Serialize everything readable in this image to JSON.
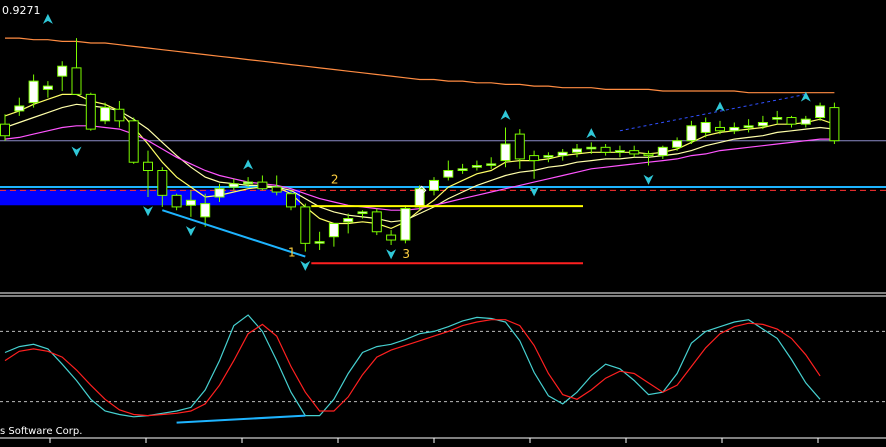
{
  "header": {
    "price_readout": "0.9271",
    "copyright": "s Software Corp."
  },
  "colors": {
    "background": "#000000",
    "bull_candle": "#ffffff",
    "bear_candle": "#000000",
    "candle_outline": "#7CFC00",
    "ma_fast": "#ffff66",
    "ma_mid": "#ffffaa",
    "ma_slow": "#ff55ff",
    "ma_long": "#ff8c42",
    "support_zone": "#0000ff",
    "support_line": "#1eb4ff",
    "fractal_arrow": "#30c8d8",
    "stoch_main": "#46d0d0",
    "stoch_signal": "#ff2020",
    "label_text": "#ffd040",
    "frame": "#ffffff"
  },
  "chart_data": [
    {
      "type": "candlestick",
      "title": "",
      "candles": [
        {
          "o": 0.4,
          "h": 0.46,
          "l": 0.3,
          "c": 0.33
        },
        {
          "o": 0.48,
          "h": 0.56,
          "l": 0.45,
          "c": 0.51
        },
        {
          "o": 0.53,
          "h": 0.7,
          "l": 0.5,
          "c": 0.66
        },
        {
          "o": 0.61,
          "h": 0.66,
          "l": 0.56,
          "c": 0.63
        },
        {
          "o": 0.69,
          "h": 0.78,
          "l": 0.6,
          "c": 0.75
        },
        {
          "o": 0.74,
          "h": 0.92,
          "l": 0.7,
          "c": 0.58
        },
        {
          "o": 0.58,
          "h": 0.59,
          "l": 0.36,
          "c": 0.37
        },
        {
          "o": 0.42,
          "h": 0.53,
          "l": 0.4,
          "c": 0.5
        },
        {
          "o": 0.49,
          "h": 0.54,
          "l": 0.38,
          "c": 0.42
        },
        {
          "o": 0.42,
          "h": 0.44,
          "l": 0.16,
          "c": 0.17
        },
        {
          "o": 0.17,
          "h": 0.24,
          "l": -0.04,
          "c": 0.12
        },
        {
          "o": 0.12,
          "h": 0.14,
          "l": -0.1,
          "c": -0.03
        },
        {
          "o": -0.03,
          "h": -0.02,
          "l": -0.12,
          "c": -0.1
        },
        {
          "o": -0.09,
          "h": 0.0,
          "l": -0.16,
          "c": -0.06
        },
        {
          "o": -0.16,
          "h": -0.02,
          "l": -0.22,
          "c": -0.08
        },
        {
          "o": -0.04,
          "h": 0.04,
          "l": -0.07,
          "c": 0.01
        },
        {
          "o": 0.02,
          "h": 0.07,
          "l": 0.0,
          "c": 0.04
        },
        {
          "o": 0.04,
          "h": 0.08,
          "l": 0.02,
          "c": 0.05
        },
        {
          "o": 0.05,
          "h": 0.09,
          "l": 0.0,
          "c": 0.01
        },
        {
          "o": 0.02,
          "h": 0.09,
          "l": -0.03,
          "c": -0.01
        },
        {
          "o": -0.02,
          "h": 0.0,
          "l": -0.12,
          "c": -0.1
        },
        {
          "o": -0.1,
          "h": -0.08,
          "l": -0.37,
          "c": -0.32
        },
        {
          "o": -0.31,
          "h": -0.25,
          "l": -0.36,
          "c": -0.31
        },
        {
          "o": -0.28,
          "h": -0.2,
          "l": -0.34,
          "c": -0.2
        },
        {
          "o": -0.19,
          "h": -0.14,
          "l": -0.26,
          "c": -0.17
        },
        {
          "o": -0.14,
          "h": -0.12,
          "l": -0.17,
          "c": -0.13
        },
        {
          "o": -0.13,
          "h": -0.11,
          "l": -0.27,
          "c": -0.25
        },
        {
          "o": -0.27,
          "h": -0.24,
          "l": -0.33,
          "c": -0.3
        },
        {
          "o": -0.3,
          "h": -0.09,
          "l": -0.32,
          "c": -0.11
        },
        {
          "o": -0.1,
          "h": 0.03,
          "l": -0.12,
          "c": 0.01
        },
        {
          "o": 0.0,
          "h": 0.08,
          "l": -0.03,
          "c": 0.06
        },
        {
          "o": 0.08,
          "h": 0.18,
          "l": 0.06,
          "c": 0.12
        },
        {
          "o": 0.12,
          "h": 0.16,
          "l": 0.1,
          "c": 0.13
        },
        {
          "o": 0.14,
          "h": 0.18,
          "l": 0.12,
          "c": 0.15
        },
        {
          "o": 0.16,
          "h": 0.2,
          "l": 0.13,
          "c": 0.16
        },
        {
          "o": 0.18,
          "h": 0.38,
          "l": 0.14,
          "c": 0.28
        },
        {
          "o": 0.34,
          "h": 0.37,
          "l": 0.13,
          "c": 0.19
        },
        {
          "o": 0.21,
          "h": 0.24,
          "l": 0.07,
          "c": 0.18
        },
        {
          "o": 0.2,
          "h": 0.23,
          "l": 0.17,
          "c": 0.21
        },
        {
          "o": 0.21,
          "h": 0.25,
          "l": 0.18,
          "c": 0.23
        },
        {
          "o": 0.23,
          "h": 0.28,
          "l": 0.2,
          "c": 0.25
        },
        {
          "o": 0.26,
          "h": 0.29,
          "l": 0.22,
          "c": 0.26
        },
        {
          "o": 0.26,
          "h": 0.28,
          "l": 0.21,
          "c": 0.23
        },
        {
          "o": 0.23,
          "h": 0.27,
          "l": 0.2,
          "c": 0.24
        },
        {
          "o": 0.24,
          "h": 0.27,
          "l": 0.2,
          "c": 0.22
        },
        {
          "o": 0.22,
          "h": 0.24,
          "l": 0.15,
          "c": 0.21
        },
        {
          "o": 0.21,
          "h": 0.27,
          "l": 0.19,
          "c": 0.26
        },
        {
          "o": 0.26,
          "h": 0.32,
          "l": 0.24,
          "c": 0.3
        },
        {
          "o": 0.3,
          "h": 0.42,
          "l": 0.28,
          "c": 0.39
        },
        {
          "o": 0.35,
          "h": 0.44,
          "l": 0.32,
          "c": 0.41
        },
        {
          "o": 0.38,
          "h": 0.42,
          "l": 0.34,
          "c": 0.36
        },
        {
          "o": 0.36,
          "h": 0.41,
          "l": 0.34,
          "c": 0.38
        },
        {
          "o": 0.38,
          "h": 0.43,
          "l": 0.35,
          "c": 0.39
        },
        {
          "o": 0.39,
          "h": 0.45,
          "l": 0.37,
          "c": 0.41
        },
        {
          "o": 0.43,
          "h": 0.48,
          "l": 0.4,
          "c": 0.44
        },
        {
          "o": 0.44,
          "h": 0.45,
          "l": 0.38,
          "c": 0.4
        },
        {
          "o": 0.4,
          "h": 0.45,
          "l": 0.38,
          "c": 0.43
        },
        {
          "o": 0.44,
          "h": 0.53,
          "l": 0.42,
          "c": 0.51
        },
        {
          "o": 0.5,
          "h": 0.53,
          "l": 0.28,
          "c": 0.3
        }
      ],
      "moving_averages": [
        {
          "role": "ma_fast",
          "values": [
            0.45,
            0.48,
            0.52,
            0.55,
            0.58,
            0.58,
            0.54,
            0.52,
            0.48,
            0.38,
            0.28,
            0.17,
            0.08,
            0.02,
            -0.04,
            -0.03,
            -0.01,
            0.01,
            0.02,
            0.02,
            -0.02,
            -0.1,
            -0.17,
            -0.2,
            -0.2,
            -0.19,
            -0.2,
            -0.23,
            -0.19,
            -0.12,
            -0.06,
            0.02,
            0.06,
            0.1,
            0.12,
            0.17,
            0.18,
            0.18,
            0.19,
            0.21,
            0.22,
            0.23,
            0.23,
            0.23,
            0.23,
            0.22,
            0.23,
            0.25,
            0.29,
            0.33,
            0.35,
            0.36,
            0.37,
            0.38,
            0.4,
            0.4,
            0.41,
            0.43,
            0.4
          ]
        },
        {
          "role": "ma_mid",
          "values": [
            0.38,
            0.41,
            0.44,
            0.47,
            0.5,
            0.52,
            0.51,
            0.5,
            0.48,
            0.43,
            0.37,
            0.29,
            0.21,
            0.14,
            0.08,
            0.05,
            0.04,
            0.03,
            0.03,
            0.02,
            0.0,
            -0.05,
            -0.1,
            -0.13,
            -0.15,
            -0.16,
            -0.17,
            -0.19,
            -0.18,
            -0.14,
            -0.1,
            -0.05,
            -0.01,
            0.03,
            0.06,
            0.09,
            0.11,
            0.12,
            0.14,
            0.15,
            0.17,
            0.18,
            0.19,
            0.19,
            0.2,
            0.2,
            0.21,
            0.22,
            0.24,
            0.27,
            0.29,
            0.31,
            0.32,
            0.33,
            0.35,
            0.36,
            0.37,
            0.38,
            0.37
          ]
        },
        {
          "role": "ma_slow",
          "values": [
            0.31,
            0.32,
            0.34,
            0.36,
            0.38,
            0.39,
            0.39,
            0.38,
            0.37,
            0.34,
            0.3,
            0.25,
            0.2,
            0.16,
            0.12,
            0.09,
            0.07,
            0.05,
            0.04,
            0.03,
            0.01,
            -0.02,
            -0.05,
            -0.07,
            -0.09,
            -0.1,
            -0.11,
            -0.12,
            -0.12,
            -0.11,
            -0.09,
            -0.07,
            -0.05,
            -0.03,
            -0.01,
            0.01,
            0.03,
            0.05,
            0.07,
            0.09,
            0.11,
            0.13,
            0.14,
            0.15,
            0.16,
            0.17,
            0.18,
            0.19,
            0.21,
            0.22,
            0.24,
            0.25,
            0.26,
            0.27,
            0.28,
            0.29,
            0.3,
            0.31,
            0.31
          ]
        },
        {
          "role": "ma_long",
          "values": [
            0.92,
            0.92,
            0.91,
            0.91,
            0.9,
            0.9,
            0.89,
            0.89,
            0.88,
            0.87,
            0.86,
            0.85,
            0.84,
            0.83,
            0.82,
            0.81,
            0.8,
            0.79,
            0.78,
            0.77,
            0.76,
            0.75,
            0.74,
            0.73,
            0.72,
            0.71,
            0.7,
            0.69,
            0.68,
            0.67,
            0.67,
            0.66,
            0.66,
            0.65,
            0.65,
            0.64,
            0.64,
            0.63,
            0.63,
            0.62,
            0.62,
            0.62,
            0.61,
            0.61,
            0.61,
            0.61,
            0.6,
            0.6,
            0.6,
            0.6,
            0.6,
            0.6,
            0.59,
            0.59,
            0.59,
            0.59,
            0.59,
            0.59,
            0.59
          ]
        }
      ],
      "levels": [
        {
          "role": "upper_blue_line",
          "value": 0.02
        },
        {
          "role": "support_zone_top",
          "value": 0.005
        },
        {
          "role": "support_zone_bottom",
          "value": -0.09
        },
        {
          "role": "dashed_red",
          "value": 0.0
        },
        {
          "role": "yellow_level",
          "value": -0.095,
          "from": 21,
          "to": 40
        },
        {
          "role": "red_level",
          "value": -0.44,
          "from": 21,
          "to": 40
        },
        {
          "role": "grey_line",
          "value": 0.3
        }
      ],
      "wave_labels": [
        {
          "text": "1",
          "index": 20,
          "value": -0.4
        },
        {
          "text": "2",
          "index": 23,
          "value": 0.04
        },
        {
          "text": "3",
          "index": 28,
          "value": -0.41
        }
      ],
      "fractals": [
        {
          "dir": "up",
          "index": 3,
          "value": 1.03
        },
        {
          "dir": "down",
          "index": 5,
          "value": 0.24
        },
        {
          "dir": "down",
          "index": 10,
          "value": -0.12
        },
        {
          "dir": "down",
          "index": 13,
          "value": -0.24
        },
        {
          "dir": "up",
          "index": 17,
          "value": 0.15
        },
        {
          "dir": "down",
          "index": 21,
          "value": -0.45
        },
        {
          "dir": "down",
          "index": 27,
          "value": -0.38
        },
        {
          "dir": "up",
          "index": 35,
          "value": 0.45
        },
        {
          "dir": "down",
          "index": 37,
          "value": 0.0
        },
        {
          "dir": "up",
          "index": 41,
          "value": 0.34
        },
        {
          "dir": "down",
          "index": 45,
          "value": 0.07
        },
        {
          "dir": "up",
          "index": 50,
          "value": 0.5
        },
        {
          "dir": "up",
          "index": 56,
          "value": 0.56
        }
      ],
      "divergence_line": {
        "from": {
          "index": 11,
          "value": -0.12
        },
        "to": {
          "index": 21,
          "value": -0.4
        }
      },
      "ylim": [
        -0.62,
        1.15
      ]
    },
    {
      "type": "line",
      "title": "",
      "ylim": [
        0,
        100
      ],
      "levels": [
        80,
        20
      ],
      "series": [
        {
          "role": "main",
          "values": [
            62,
            67,
            69,
            65,
            52,
            38,
            22,
            12,
            9,
            7,
            8,
            10,
            12,
            15,
            30,
            55,
            85,
            94,
            80,
            55,
            28,
            8,
            8,
            22,
            44,
            62,
            67,
            69,
            73,
            78,
            80,
            84,
            89,
            92,
            91,
            88,
            72,
            45,
            25,
            18,
            28,
            42,
            52,
            48,
            38,
            26,
            28,
            44,
            70,
            80,
            84,
            88,
            90,
            82,
            74,
            56,
            36,
            22
          ]
        },
        {
          "role": "signal",
          "values": [
            55,
            63,
            65,
            63,
            58,
            47,
            34,
            22,
            13,
            9,
            8,
            9,
            10,
            12,
            18,
            34,
            55,
            78,
            86,
            76,
            50,
            28,
            12,
            12,
            24,
            43,
            58,
            64,
            68,
            72,
            76,
            80,
            85,
            88,
            90,
            90,
            85,
            68,
            44,
            26,
            22,
            30,
            40,
            46,
            44,
            36,
            28,
            34,
            50,
            66,
            78,
            84,
            87,
            86,
            82,
            74,
            60,
            42
          ]
        }
      ],
      "divergence_line": {
        "from": {
          "index": 12,
          "value": 2
        },
        "to": {
          "index": 21,
          "value": 8
        }
      }
    }
  ]
}
